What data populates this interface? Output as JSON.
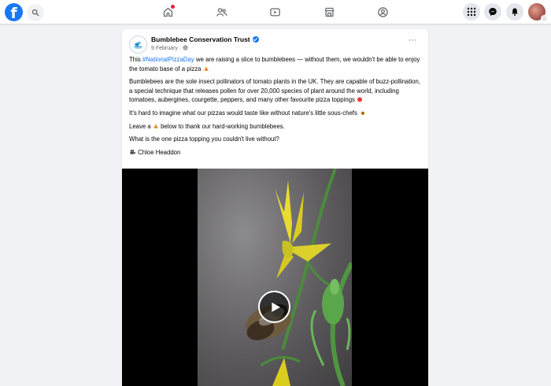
{
  "topbar": {
    "logo_glyph": "f",
    "nav": [
      "home-icon",
      "friends-icon",
      "watch-icon",
      "marketplace-icon",
      "groups-icon"
    ],
    "actions": [
      "menu-grid-icon",
      "messenger-icon",
      "notifications-icon"
    ]
  },
  "post": {
    "page_name": "Bumblebee Conservation Trust",
    "date": "9 February · ",
    "more_label": "···",
    "line1_pre": "This ",
    "hashtag": "#NationalPizzaDay",
    "line1_post": " we are raising a slice to bumblebees — without them, we wouldn't be able to enjoy the tomato base of a pizza ",
    "para2": "Bumblebees are the sole insect pollinators of tomato plants in the UK. They are capable of buzz-pollination, a special technique that releases pollen for over 20,000 species of plant around the world, including tomatoes, aubergines, courgette, peppers, and many other favourite pizza toppings ",
    "para3": "It's hard to imagine what our pizzas would taste like without nature's little sous-chefs ",
    "para4_pre": "Leave a ",
    "para4_post": " below to thank our hard-working bumblebees.",
    "para5": "What is the one pizza topping you couldn't live without?",
    "credit": "Chloe Headdon"
  },
  "colors": {
    "brand": "#1877f2",
    "background": "#f0f2f5"
  }
}
